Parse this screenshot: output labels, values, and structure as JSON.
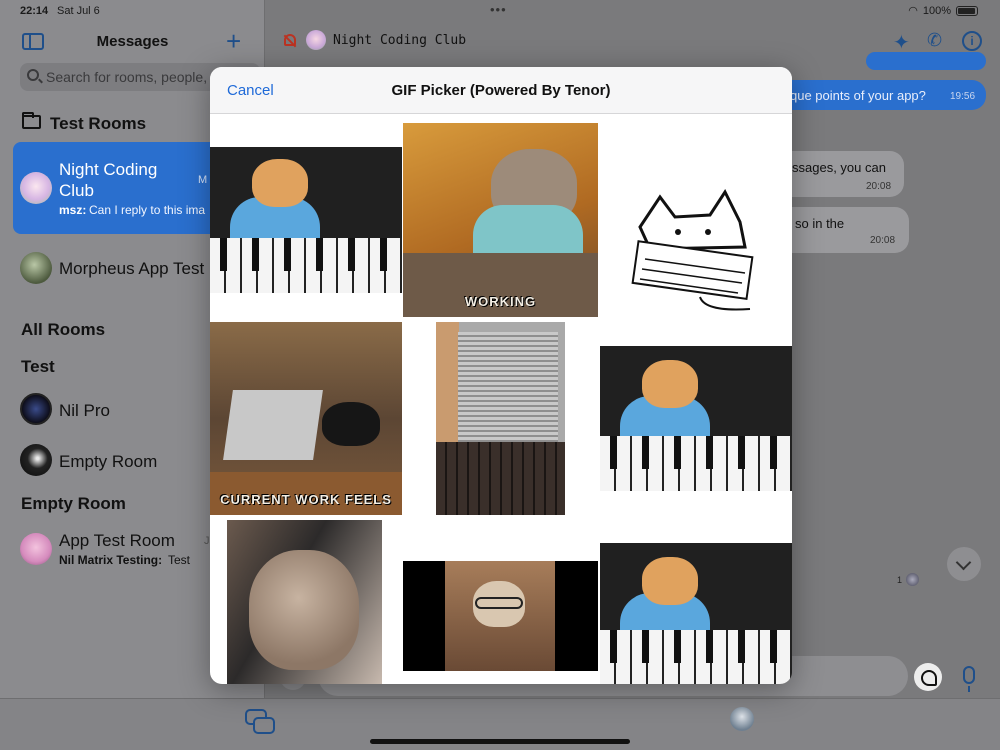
{
  "status": {
    "time": "22:14",
    "date": "Sat Jul 6",
    "battery": "100%"
  },
  "sidebar": {
    "title": "Messages",
    "search_placeholder": "Search for rooms, people, messages",
    "folder_label": "Test Rooms",
    "selected_room": {
      "name_line1": "Night Coding",
      "name_line2": "Club",
      "sender": "msz:",
      "preview": "Can I reply to this ima",
      "time": "M"
    },
    "room_morpheus": "Morpheus App Test",
    "all_rooms": "All Rooms",
    "test_label": "Test",
    "nil_pro": "Nil Pro",
    "empty_room_item": "Empty Room",
    "empty_room_section": "Empty Room",
    "app_test_room": {
      "name": "App Test Room",
      "sender": "Nil Matrix Testing:",
      "preview": "Test",
      "time": "J"
    }
  },
  "chat": {
    "title": "Night Coding Club",
    "messages": [
      {
        "text": "que points of your app?",
        "time": "19:56"
      },
      {
        "text": "ssages, you can",
        "time": "20:08"
      },
      {
        "text": "so in the",
        "time": "20:08"
      }
    ],
    "read_count": "1"
  },
  "modal": {
    "cancel_label": "Cancel",
    "title": "GIF Picker (Powered By Tenor)",
    "gifs": [
      {
        "name": "keyboard-cat"
      },
      {
        "name": "working-cat",
        "caption": "WORKING"
      },
      {
        "name": "bongo-cat"
      },
      {
        "name": "laptop-cat",
        "caption": "CURRENT WORK FEELS"
      },
      {
        "name": "closeup-laptop-cat"
      },
      {
        "name": "keyboard-cat"
      },
      {
        "name": "sleepy-cat"
      },
      {
        "name": "glasses-cat"
      },
      {
        "name": "keyboard-cat"
      }
    ]
  },
  "colors": {
    "accent": "#2a6fce",
    "link": "#1f6ad8"
  }
}
